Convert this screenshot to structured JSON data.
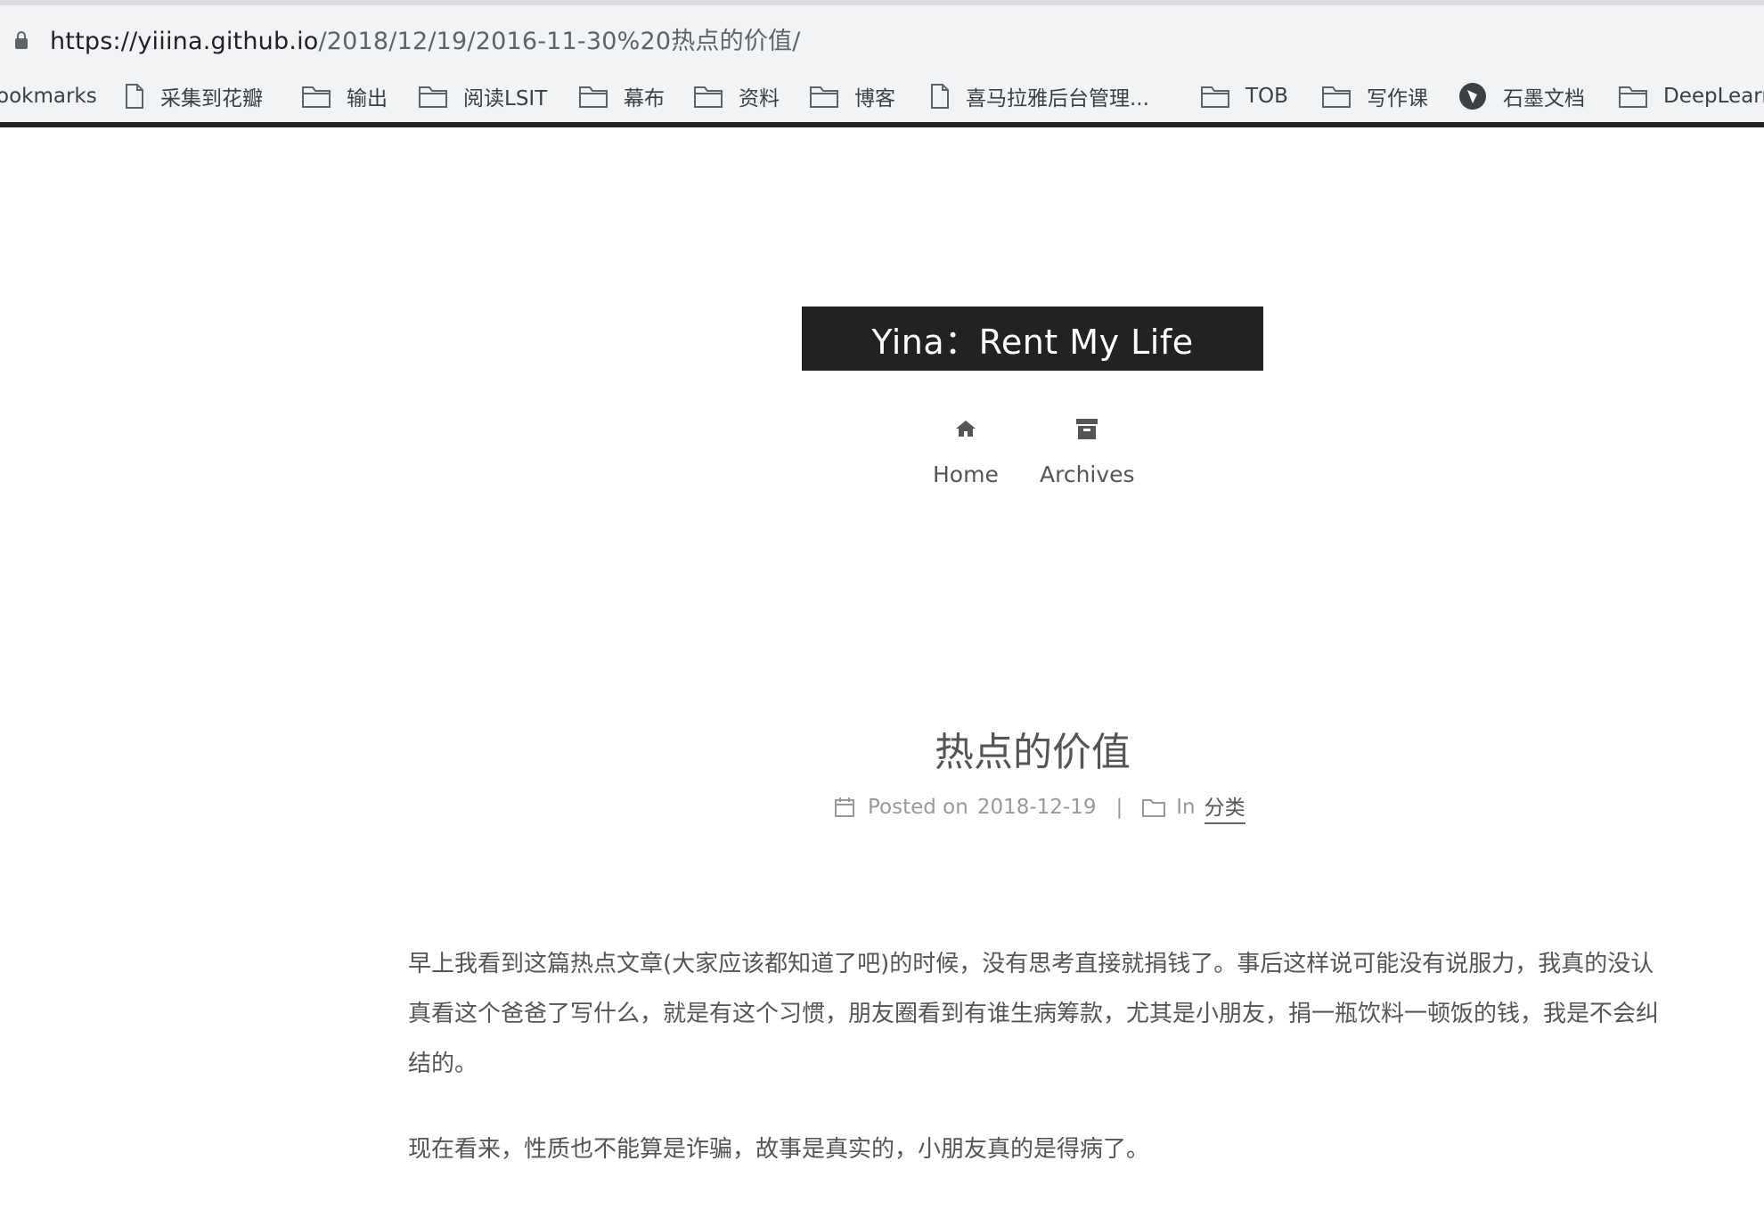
{
  "browser": {
    "url_host": "https://yiiina.github.io",
    "url_path": "/2018/12/19/2016-11-30%20热点的价值/"
  },
  "bookmarks": [
    {
      "label": "ookmarks",
      "icon": "none"
    },
    {
      "label": "采集到花瓣",
      "icon": "page-icon"
    },
    {
      "label": "输出",
      "icon": "folder-icon"
    },
    {
      "label": "阅读LSIT",
      "icon": "folder-icon"
    },
    {
      "label": "幕布",
      "icon": "folder-icon"
    },
    {
      "label": "资料",
      "icon": "folder-icon"
    },
    {
      "label": "博客",
      "icon": "folder-icon"
    },
    {
      "label": "喜马拉雅后台管理...",
      "icon": "page-icon"
    },
    {
      "label": "TOB",
      "icon": "folder-icon"
    },
    {
      "label": "写作课",
      "icon": "folder-icon"
    },
    {
      "label": "石墨文档",
      "icon": "shimo-logo-icon"
    },
    {
      "label": "DeepLearn",
      "icon": "folder-icon"
    }
  ],
  "site": {
    "title": "Yina：Rent My Life",
    "nav": [
      {
        "label": "Home",
        "icon": "home-icon"
      },
      {
        "label": "Archives",
        "icon": "archive-icon"
      }
    ]
  },
  "post": {
    "title": "热点的价值",
    "posted_on_label": "Posted on",
    "date": "2018-12-19",
    "in_label": "In",
    "category": "分类",
    "paragraphs": [
      "早上我看到这篇热点文章(大家应该都知道了吧)的时候，没有思考直接就捐钱了。事后这样说可能没有说服力，我真的没认真看这个爸爸了写什么，就是有这个习惯，朋友圈看到有谁生病筹款，尤其是小朋友，捐一瓶饮料一顿饭的钱，我是不会纠结的。",
      "现在看来，性质也不能算是诈骗，故事是真实的，小朋友真的是得病了。"
    ]
  },
  "colors": {
    "title_box_bg": "#222222",
    "text": "#555555",
    "meta": "#999999",
    "chrome_bg": "#f1f3f4"
  }
}
